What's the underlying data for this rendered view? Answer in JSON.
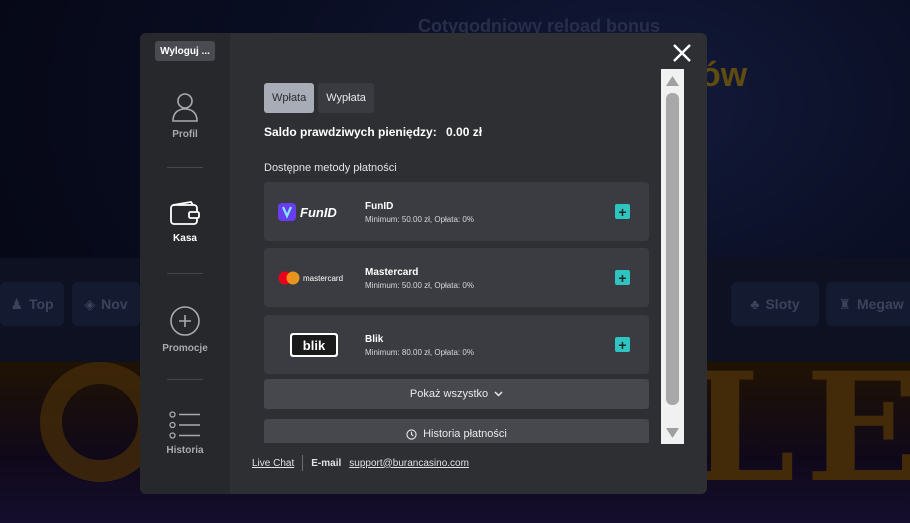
{
  "background": {
    "heading": "Cotygodniowy reload bonus",
    "heading2": "ów",
    "nav_pills": [
      {
        "label": "Top",
        "icon": "user-icon"
      },
      {
        "label": "Nov",
        "icon": "gift-icon"
      },
      {
        "label": "Sloty",
        "icon": "game-icon"
      },
      {
        "label": "Megaw",
        "icon": "trophy-icon"
      }
    ],
    "banner_letters": "LE"
  },
  "sidebar": {
    "logout_label": "Wyloguj ...",
    "items": [
      {
        "label": "Profil",
        "icon": "user-icon",
        "active": false
      },
      {
        "label": "Kasa",
        "icon": "wallet-icon",
        "active": true
      },
      {
        "label": "Promocje",
        "icon": "plus-circle-icon",
        "active": false
      },
      {
        "label": "Historia",
        "icon": "list-icon",
        "active": false
      }
    ]
  },
  "tabs": [
    {
      "label": "Wpłata",
      "active": true
    },
    {
      "label": "Wypłata",
      "active": false
    }
  ],
  "balance": {
    "label": "Saldo prawdziwych pieniędzy:",
    "amount": "0.00 zł"
  },
  "methods_title": "Dostępne metody płatności",
  "methods": [
    {
      "name": "FunID",
      "logo_text": "FunID",
      "meta": "Minimum: 50.00 zł, Opłata: 0%"
    },
    {
      "name": "Mastercard",
      "logo_text": "mastercard",
      "meta": "Minimum: 50.00 zł, Opłata: 0%"
    },
    {
      "name": "Blik",
      "logo_text": "blik",
      "meta": "Minimum: 80.00 zł, Opłata: 0%"
    }
  ],
  "show_all_label": "Pokaż wszystko",
  "history_label": "Historia płatności",
  "footer": {
    "live_chat": "Live Chat",
    "email_label": "E-mail",
    "email": "support@burancasino.com"
  },
  "colors": {
    "accent": "#2ec5c0",
    "modal_bg": "#2e2f33",
    "sidebar_bg": "#27282b",
    "card_bg": "#3b3c41"
  }
}
